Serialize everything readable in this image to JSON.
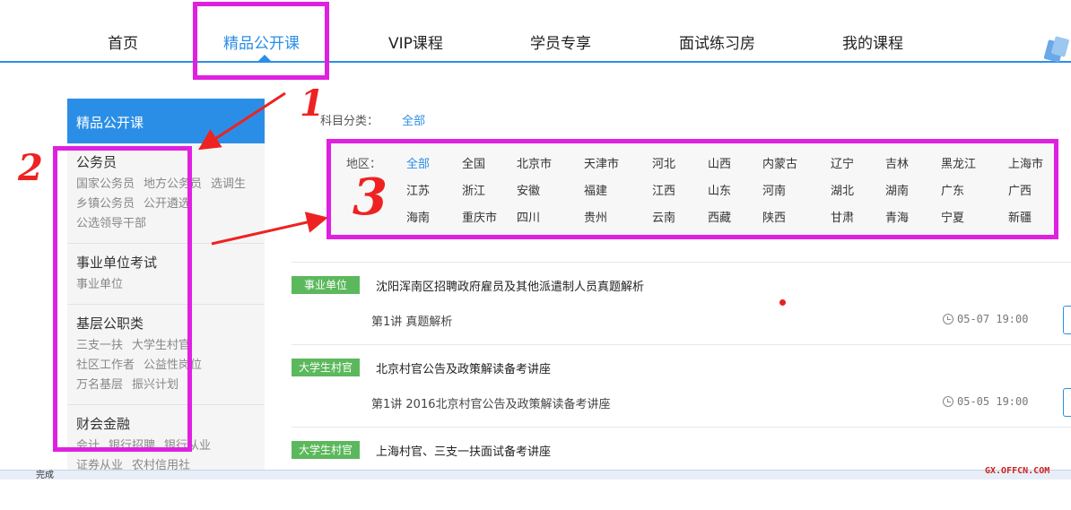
{
  "nav": {
    "items": [
      {
        "label": "首页"
      },
      {
        "label": "精品公开课"
      },
      {
        "label": "VIP课程"
      },
      {
        "label": "学员专享"
      },
      {
        "label": "面试练习房"
      },
      {
        "label": "我的课程"
      }
    ]
  },
  "sidebar": {
    "heading": "精品公开课",
    "groups": [
      {
        "title": "公务员",
        "links": [
          "国家公务员",
          "地方公务员",
          "选调生",
          "乡镇公务员",
          "公开遴选",
          "公选领导干部"
        ]
      },
      {
        "title": "事业单位考试",
        "links": [
          "事业单位"
        ]
      },
      {
        "title": "基层公职类",
        "links": [
          "三支一扶",
          "大学生村官",
          "社区工作者",
          "公益性岗位",
          "万名基层",
          "振兴计划"
        ]
      },
      {
        "title": "财会金融",
        "links": [
          "会计",
          "银行招聘",
          "银行从业",
          "证券从业",
          "农村信用社"
        ]
      }
    ]
  },
  "filters": {
    "subject_label": "科目分类：",
    "subject_value": "全部",
    "region_label": "地区：",
    "regions": [
      "全部",
      "全国",
      "北京市",
      "天津市",
      "河北",
      "山西",
      "内蒙古",
      "辽宁",
      "吉林",
      "黑龙江",
      "上海市",
      "江苏",
      "浙江",
      "安徽",
      "福建",
      "江西",
      "山东",
      "河南",
      "湖北",
      "湖南",
      "广东",
      "广西",
      "海南",
      "重庆市",
      "四川",
      "贵州",
      "云南",
      "西藏",
      "陕西",
      "甘肃",
      "青海",
      "宁夏",
      "新疆"
    ]
  },
  "courses": [
    {
      "tag": "事业单位",
      "title": "沈阳浑南区招聘政府雇员及其他派遣制人员真题解析",
      "lesson": "第1讲 真题解析",
      "time": "05-07 19:00"
    },
    {
      "tag": "大学生村官",
      "title": "北京村官公告及政策解读备考讲座",
      "lesson": "第1讲 2016北京村官公告及政策解读备考讲座",
      "time": "05-05 19:00"
    },
    {
      "tag": "大学生村官",
      "title": "上海村官、三支一扶面试备考讲座",
      "lesson": "",
      "time": ""
    }
  ],
  "annotations": [
    "1",
    "2",
    "3"
  ],
  "status_text": "完成",
  "watermark": "GX.OFFCN.COM",
  "colors": {
    "accent": "#2b8ee6",
    "annotation_box": "#e020e0",
    "annotation_arrow": "#ee2222",
    "tag": "#5cb85c"
  }
}
